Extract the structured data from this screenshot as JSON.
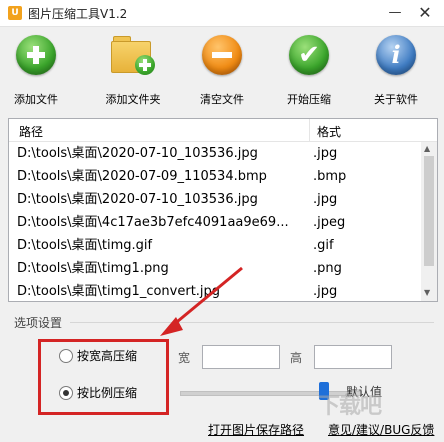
{
  "window": {
    "title": "图片压缩工具V1.2",
    "app_icon_glyph": "U",
    "minimize_glyph": "—",
    "close_glyph": "✕"
  },
  "toolbar": {
    "add_file": "添加文件",
    "add_folder": "添加文件夹",
    "clear_files": "清空文件",
    "start_compress": "开始压缩",
    "about": "关于软件",
    "check_glyph": "✔",
    "info_glyph": "i"
  },
  "file_list": {
    "columns": {
      "path": "路径",
      "format": "格式"
    },
    "rows": [
      {
        "path": "D:\\tools\\桌面\\2020-07-10_103536.jpg",
        "format": ".jpg"
      },
      {
        "path": "D:\\tools\\桌面\\2020-07-09_110534.bmp",
        "format": ".bmp"
      },
      {
        "path": "D:\\tools\\桌面\\2020-07-10_103536.jpg",
        "format": ".jpg"
      },
      {
        "path": "D:\\tools\\桌面\\4c17ae3b7efc4091aa9e69...",
        "format": ".jpeg"
      },
      {
        "path": "D:\\tools\\桌面\\timg.gif",
        "format": ".gif"
      },
      {
        "path": "D:\\tools\\桌面\\timg1.png",
        "format": ".png"
      },
      {
        "path": "D:\\tools\\桌面\\timg1_convert.jpg",
        "format": ".jpg"
      }
    ],
    "scroll_up_glyph": "▲",
    "scroll_down_glyph": "▼"
  },
  "options": {
    "section_title": "选项设置",
    "by_size_label": "按宽高压缩",
    "by_ratio_label": "按比例压缩",
    "selected_mode": "按比例压缩",
    "width_label": "宽",
    "height_label": "高",
    "width_value": "",
    "height_value": "",
    "ratio_label": "默认值",
    "ratio_position_fraction": 0.8
  },
  "footer": {
    "open_save_path": "打开图片保存路径",
    "feedback": "意见/建议/BUG反馈"
  },
  "annotation": {
    "color": "#d42424"
  },
  "watermark": "下载吧"
}
